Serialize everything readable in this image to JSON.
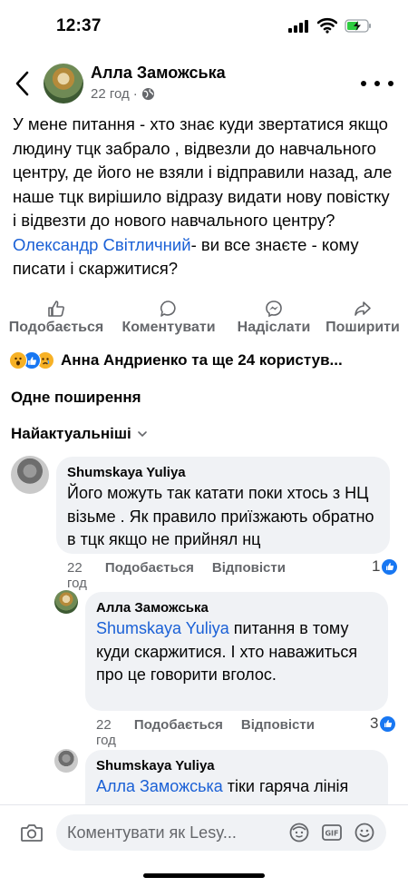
{
  "status_bar": {
    "time": "12:37"
  },
  "post": {
    "author": "Алла Заможська",
    "time": "22 год",
    "privacy_icon": "globe-icon",
    "text_parts": [
      "У мене питання - хто знає куди звертатися якщо людину тцк забрало , відвезли до навчального центру, де його не взяли і відправили назад, але наше тцк вирішило відразу видати нову повістку і відвезти до нового навчального центру?",
      "Олександр Світличний",
      "- ви все знаєте - кому писати і скаржитися?"
    ]
  },
  "actions": {
    "like": "Подобається",
    "comment": "Коментувати",
    "send": "Надіслати",
    "share": "Поширити"
  },
  "reactions": {
    "icons": [
      "wow-reaction-icon",
      "like-reaction-icon",
      "sad-reaction-icon"
    ],
    "text": "Анна Андриенко та ще 24 користув..."
  },
  "shares_text": "Одне поширення",
  "sort_label": "Найактуальніші",
  "comments": [
    {
      "author": "Shumskaya  Yuliya",
      "text": "Його можуть так катати поки хтось з НЦ візьме . Як правило приїзжають обратно в тцк якщо не прийнял нц",
      "time": "22 год",
      "like": "Подобається",
      "reply": "Відповісти",
      "likes": "1"
    },
    {
      "author": "Алла Заможська",
      "mention": "Shumskaya  Yuliya",
      "text": " питання в тому куди скаржитися. І хто наважиться про це говорити вголос.",
      "time": "22 год",
      "like": "Подобається",
      "reply": "Відповісти",
      "likes": "3"
    },
    {
      "author": "Shumskaya  Yuliya",
      "mention": "Алла Заможська",
      "text": " тіки гаряча лінія"
    }
  ],
  "composer": {
    "placeholder": "Коментувати як Lesy..."
  },
  "colors": {
    "link": "#1a60d6",
    "like_blue": "#1877f2",
    "secondary_text": "#65676b",
    "bubble_bg": "#f0f2f5"
  }
}
